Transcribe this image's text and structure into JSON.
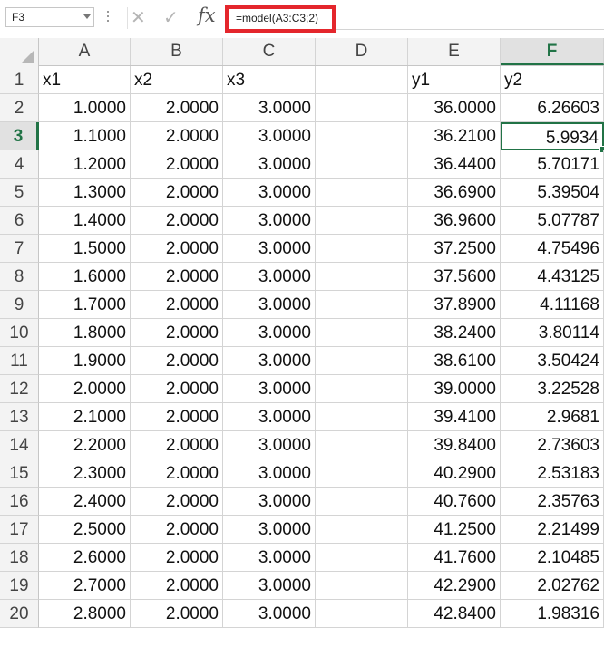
{
  "name_box": {
    "value": "F3"
  },
  "formula_bar": {
    "cancel_glyph": "✕",
    "enter_glyph": "✓",
    "fx_label": "fx",
    "formula": "=model(A3:C3;2)"
  },
  "active_cell": {
    "column": "F",
    "row": "3"
  },
  "columns": [
    "A",
    "B",
    "C",
    "D",
    "E",
    "F"
  ],
  "rows": [
    {
      "n": "1",
      "a": "x1",
      "b": "x2",
      "c": "x3",
      "d": "",
      "e": "y1",
      "f": "y2"
    },
    {
      "n": "2",
      "a": "1.0000",
      "b": "2.0000",
      "c": "3.0000",
      "d": "",
      "e": "36.0000",
      "f": "6.26603"
    },
    {
      "n": "3",
      "a": "1.1000",
      "b": "2.0000",
      "c": "3.0000",
      "d": "",
      "e": "36.2100",
      "f": "5.9934"
    },
    {
      "n": "4",
      "a": "1.2000",
      "b": "2.0000",
      "c": "3.0000",
      "d": "",
      "e": "36.4400",
      "f": "5.70171"
    },
    {
      "n": "5",
      "a": "1.3000",
      "b": "2.0000",
      "c": "3.0000",
      "d": "",
      "e": "36.6900",
      "f": "5.39504"
    },
    {
      "n": "6",
      "a": "1.4000",
      "b": "2.0000",
      "c": "3.0000",
      "d": "",
      "e": "36.9600",
      "f": "5.07787"
    },
    {
      "n": "7",
      "a": "1.5000",
      "b": "2.0000",
      "c": "3.0000",
      "d": "",
      "e": "37.2500",
      "f": "4.75496"
    },
    {
      "n": "8",
      "a": "1.6000",
      "b": "2.0000",
      "c": "3.0000",
      "d": "",
      "e": "37.5600",
      "f": "4.43125"
    },
    {
      "n": "9",
      "a": "1.7000",
      "b": "2.0000",
      "c": "3.0000",
      "d": "",
      "e": "37.8900",
      "f": "4.11168"
    },
    {
      "n": "10",
      "a": "1.8000",
      "b": "2.0000",
      "c": "3.0000",
      "d": "",
      "e": "38.2400",
      "f": "3.80114"
    },
    {
      "n": "11",
      "a": "1.9000",
      "b": "2.0000",
      "c": "3.0000",
      "d": "",
      "e": "38.6100",
      "f": "3.50424"
    },
    {
      "n": "12",
      "a": "2.0000",
      "b": "2.0000",
      "c": "3.0000",
      "d": "",
      "e": "39.0000",
      "f": "3.22528"
    },
    {
      "n": "13",
      "a": "2.1000",
      "b": "2.0000",
      "c": "3.0000",
      "d": "",
      "e": "39.4100",
      "f": "2.9681"
    },
    {
      "n": "14",
      "a": "2.2000",
      "b": "2.0000",
      "c": "3.0000",
      "d": "",
      "e": "39.8400",
      "f": "2.73603"
    },
    {
      "n": "15",
      "a": "2.3000",
      "b": "2.0000",
      "c": "3.0000",
      "d": "",
      "e": "40.2900",
      "f": "2.53183"
    },
    {
      "n": "16",
      "a": "2.4000",
      "b": "2.0000",
      "c": "3.0000",
      "d": "",
      "e": "40.7600",
      "f": "2.35763"
    },
    {
      "n": "17",
      "a": "2.5000",
      "b": "2.0000",
      "c": "3.0000",
      "d": "",
      "e": "41.2500",
      "f": "2.21499"
    },
    {
      "n": "18",
      "a": "2.6000",
      "b": "2.0000",
      "c": "3.0000",
      "d": "",
      "e": "41.7600",
      "f": "2.10485"
    },
    {
      "n": "19",
      "a": "2.7000",
      "b": "2.0000",
      "c": "3.0000",
      "d": "",
      "e": "42.2900",
      "f": "2.02762"
    },
    {
      "n": "20",
      "a": "2.8000",
      "b": "2.0000",
      "c": "3.0000",
      "d": "",
      "e": "42.8400",
      "f": "1.98316"
    }
  ],
  "colors": {
    "accent_green": "#217346",
    "highlight_red": "#e4262c"
  }
}
